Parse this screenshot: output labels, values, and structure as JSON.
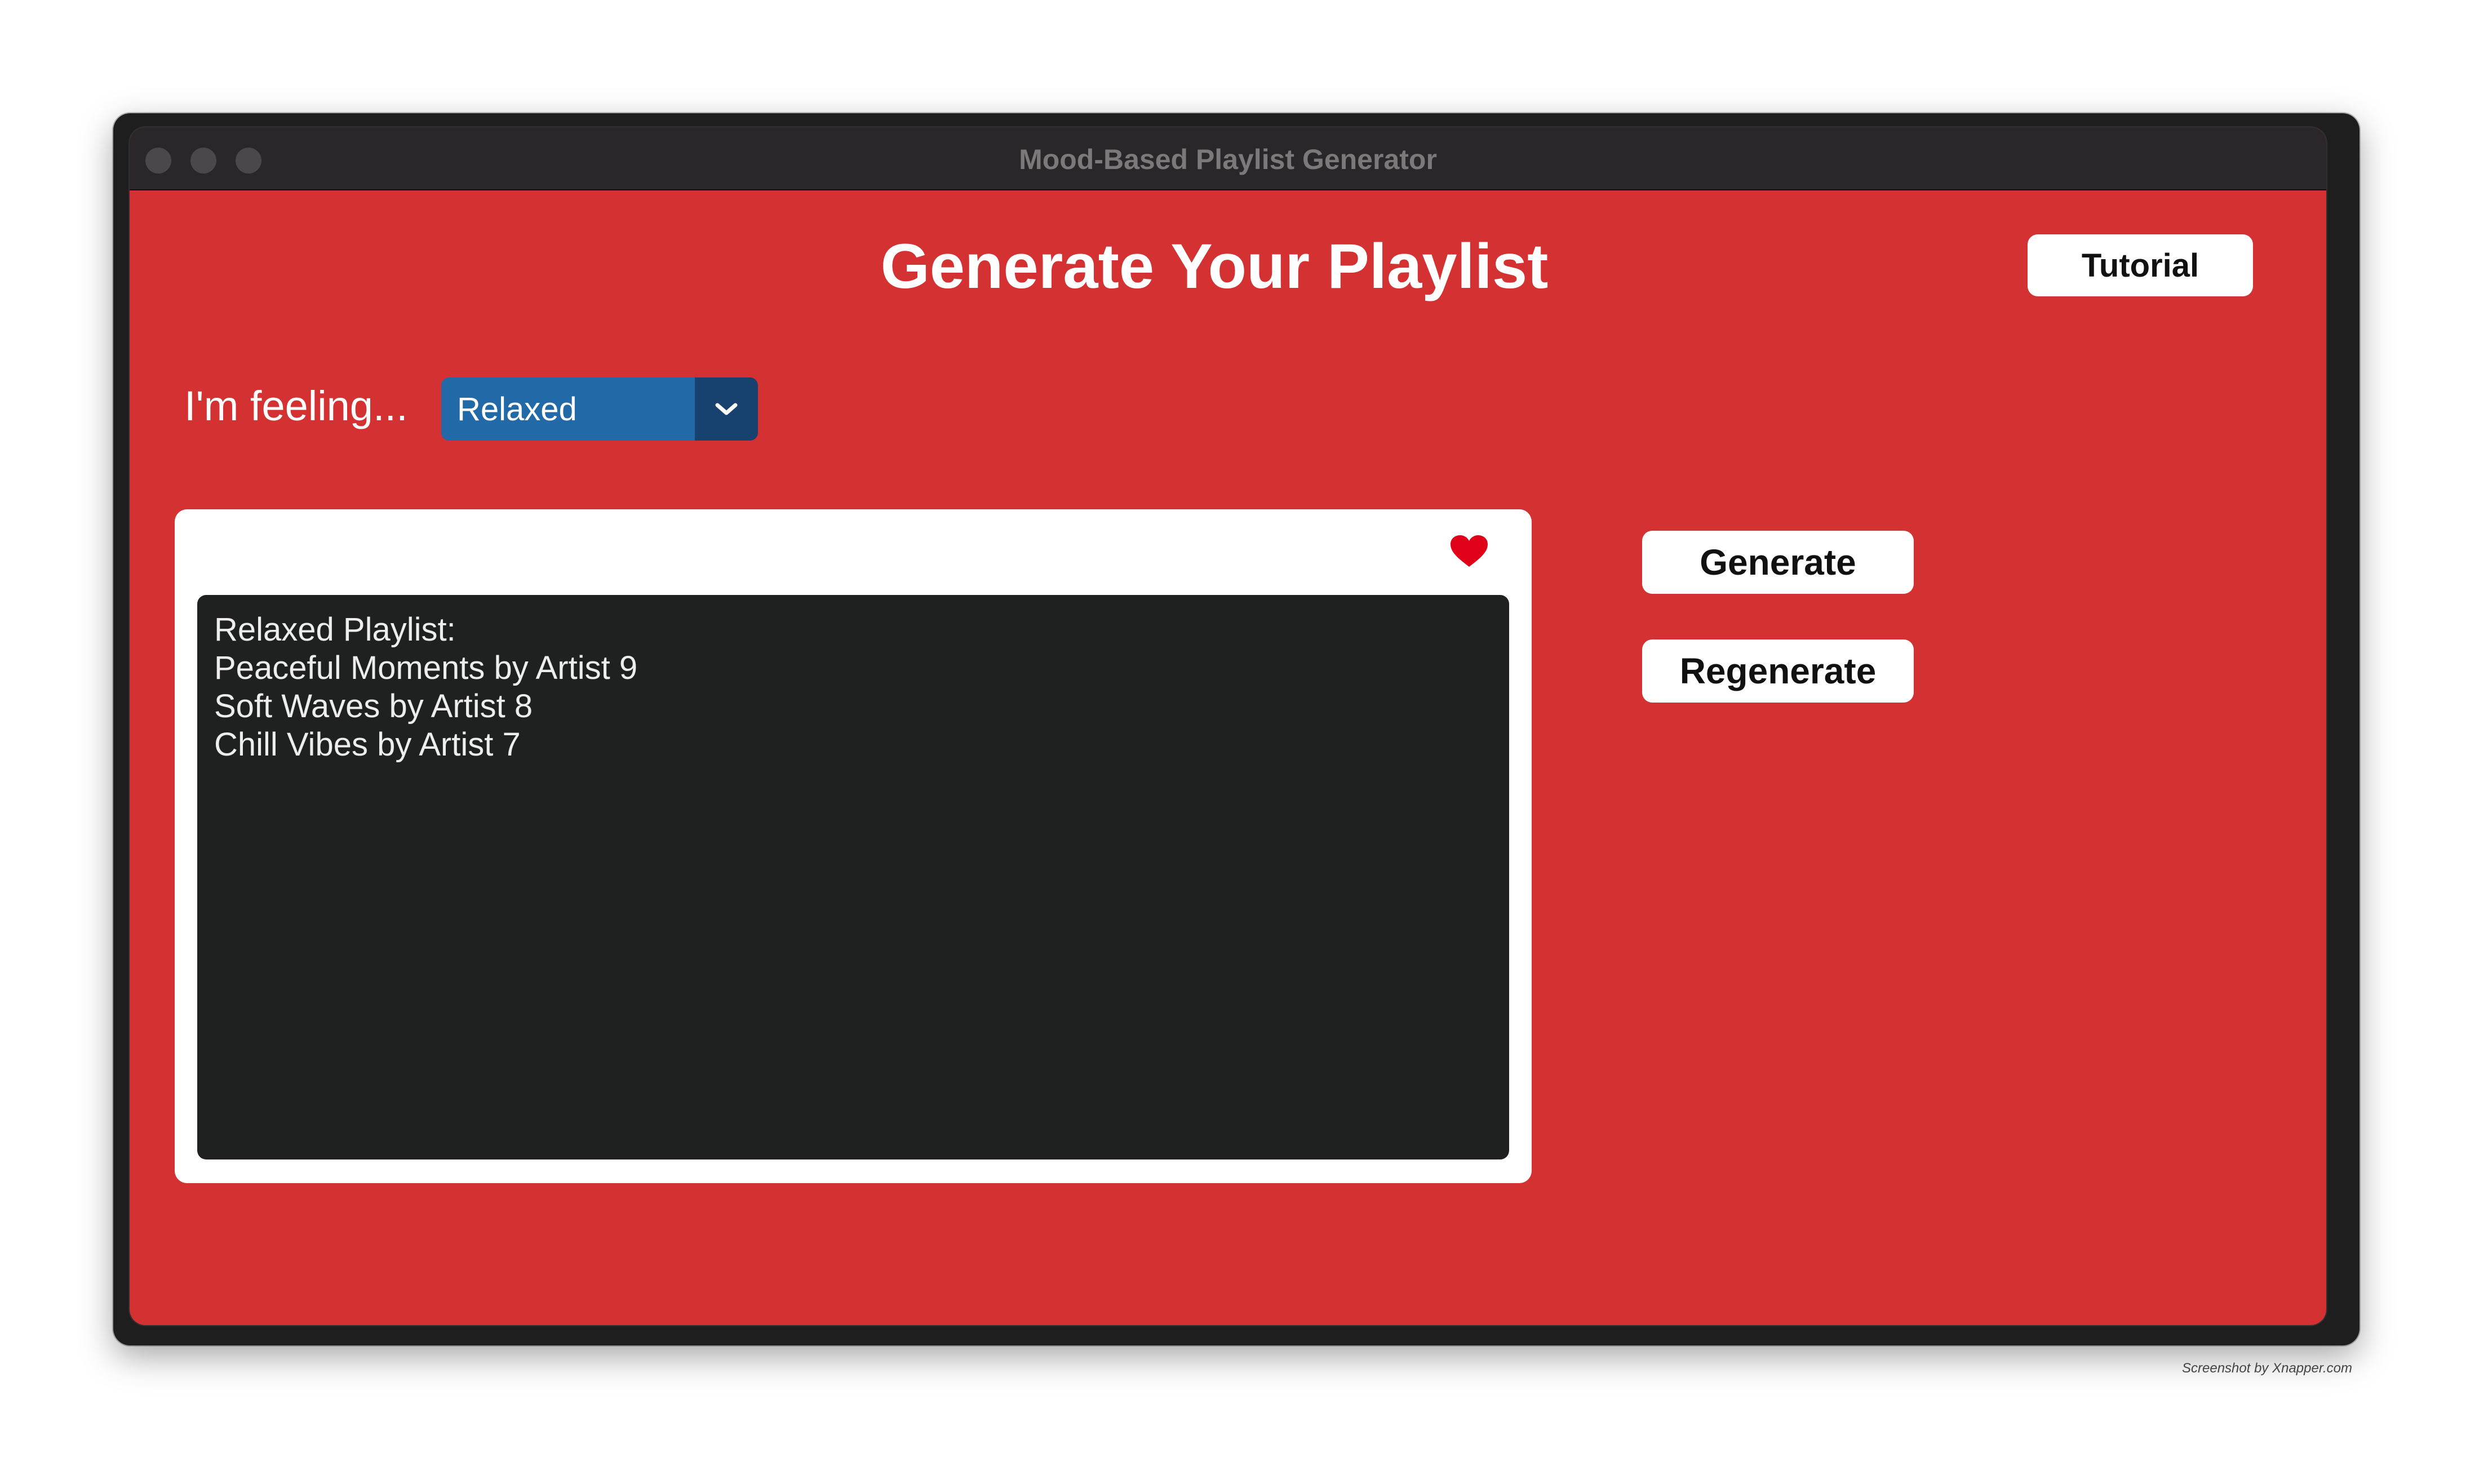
{
  "window": {
    "title": "Mood-Based Playlist Generator"
  },
  "header": {
    "title": "Generate Your Playlist",
    "tutorial_label": "Tutorial"
  },
  "mood": {
    "label": "I'm feeling...",
    "selected": "Relaxed"
  },
  "playlist": {
    "lines": [
      "Relaxed Playlist:",
      "Peaceful Moments by Artist 9",
      "Soft Waves by Artist 8",
      "Chill Vibes by Artist 7"
    ],
    "favorite_icon": "heart-icon"
  },
  "actions": {
    "generate_label": "Generate",
    "regenerate_label": "Regenerate"
  },
  "colors": {
    "background": "#d33132",
    "titlebar": "#2b2629",
    "select": "#2269a8",
    "select_arrow": "#17416f",
    "playlist_bg": "#1f2020",
    "heart": "#e0001a"
  },
  "credit": "Screenshot by Xnapper.com"
}
